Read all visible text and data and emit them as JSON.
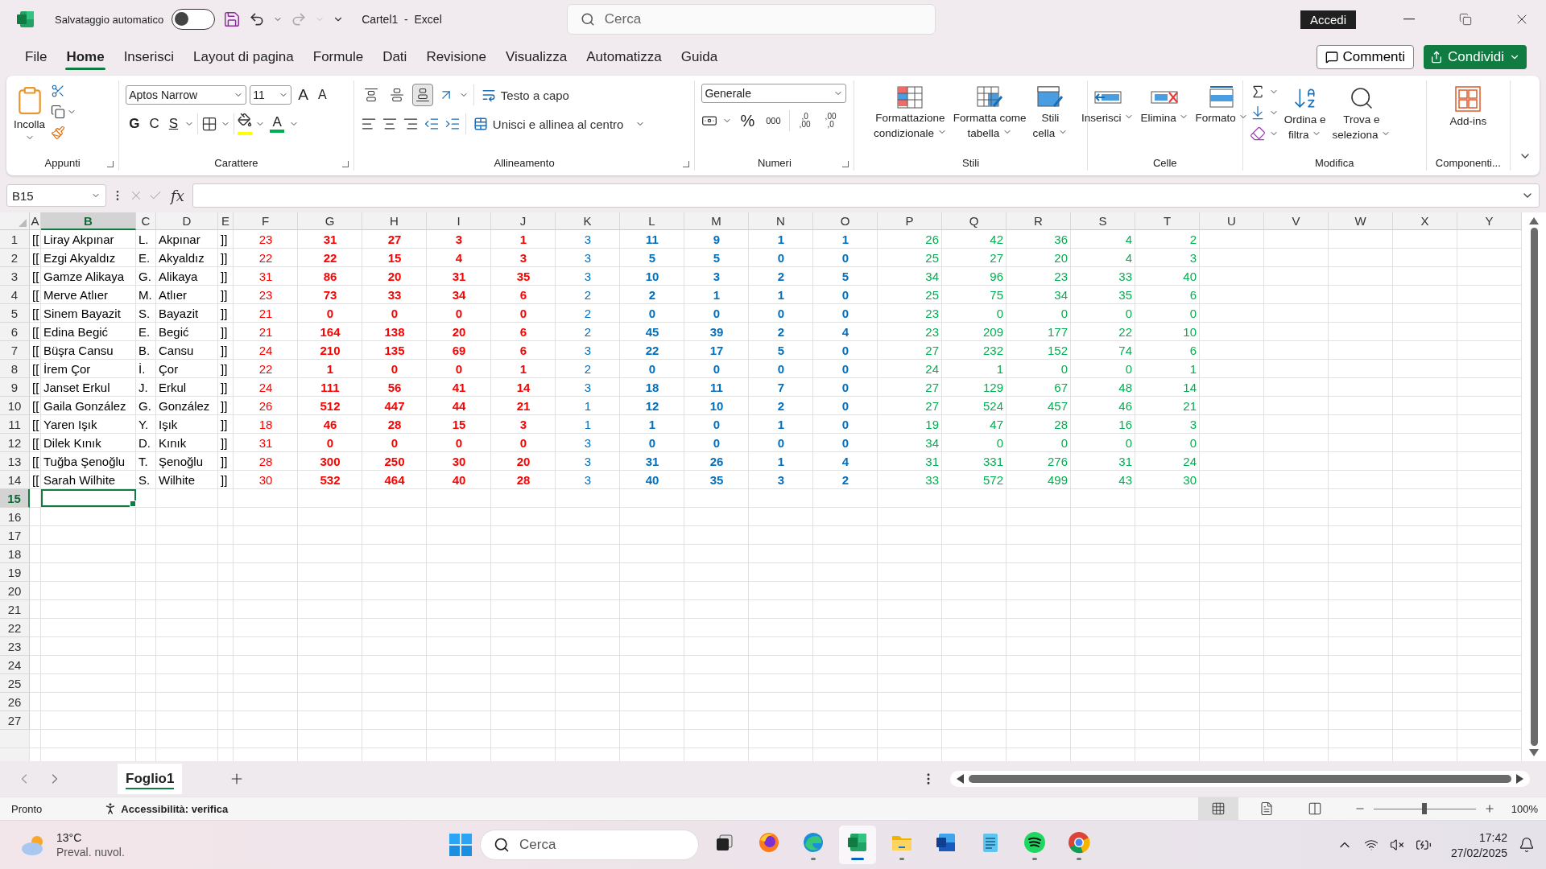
{
  "title_bar": {
    "autosave": {
      "label": "Salvataggio automatico",
      "on": false
    },
    "document_title": "Cartel1  -  Excel",
    "search": {
      "placeholder": "Cerca"
    },
    "account_button": "Accedi"
  },
  "menu_tabs": [
    {
      "label": "File",
      "selected": false
    },
    {
      "label": "Home",
      "selected": true
    },
    {
      "label": "Inserisci",
      "selected": false
    },
    {
      "label": "Layout di pagina",
      "selected": false
    },
    {
      "label": "Formule",
      "selected": false
    },
    {
      "label": "Dati",
      "selected": false
    },
    {
      "label": "Revisione",
      "selected": false
    },
    {
      "label": "Visualizza",
      "selected": false
    },
    {
      "label": "Automatizza",
      "selected": false
    },
    {
      "label": "Guida",
      "selected": false
    }
  ],
  "comments_button": "Commenti",
  "share_button": "Condividi",
  "ribbon": {
    "clipboard": {
      "label": "Appunti",
      "paste": "Incolla"
    },
    "font": {
      "label": "Carattere",
      "font_name": "Aptos Narrow",
      "font_size": "11",
      "grow": "A",
      "shrink": "A",
      "bold": "G",
      "italic": "C",
      "underline": "S",
      "font_color": "A"
    },
    "alignment": {
      "label": "Allineamento",
      "vertical": [
        {
          "selected": false
        },
        {
          "selected": false
        },
        {
          "selected": true
        }
      ],
      "wrap": "Testo a capo",
      "merge": "Unisci e allinea al centro"
    },
    "number": {
      "label": "Numeri",
      "format": "Generale",
      "percent": "%",
      "thousands": "000",
      "increase_decimal": [
        ",0",
        ",00"
      ],
      "decrease_decimal": [
        ",00",
        ",0"
      ]
    },
    "styles": {
      "label": "Stili",
      "buttons": [
        {
          "lines": [
            "Formattazione",
            "condizionale"
          ]
        },
        {
          "lines": [
            "Formatta come",
            "tabella"
          ]
        },
        {
          "lines": [
            "Stili",
            "cella"
          ]
        }
      ]
    },
    "cells": {
      "label": "Celle",
      "buttons": [
        {
          "lines": [
            "Inserisci"
          ]
        },
        {
          "lines": [
            "Elimina"
          ]
        },
        {
          "lines": [
            "Formato"
          ]
        }
      ]
    },
    "editing": {
      "label": "Modifica",
      "buttons": [
        {
          "lines": [
            "Ordina e",
            "filtra"
          ]
        },
        {
          "lines": [
            "Trova e",
            "seleziona"
          ]
        }
      ]
    },
    "addins": {
      "label": "Componenti...",
      "button": "Add-ins"
    }
  },
  "formula_bar": {
    "name_box": "B15",
    "function_label": "fx"
  },
  "columns": [
    {
      "letter": "A",
      "kind": "text",
      "selected": false
    },
    {
      "letter": "B",
      "kind": "text",
      "selected": true
    },
    {
      "letter": "C",
      "kind": "text",
      "selected": false
    },
    {
      "letter": "D",
      "kind": "text",
      "selected": false
    },
    {
      "letter": "E",
      "kind": "text",
      "selected": false
    },
    {
      "letter": "F",
      "kind": "centered",
      "color": "#ff0000",
      "bold": false,
      "selected": false
    },
    {
      "letter": "G",
      "kind": "centered",
      "color": "#ff0000",
      "bold": true,
      "selected": false
    },
    {
      "letter": "H",
      "kind": "centered",
      "color": "#ff0000",
      "bold": true,
      "selected": false
    },
    {
      "letter": "I",
      "kind": "centered",
      "color": "#ff0000",
      "bold": true,
      "selected": false
    },
    {
      "letter": "J",
      "kind": "centered",
      "color": "#ff0000",
      "bold": true,
      "selected": false
    },
    {
      "letter": "K",
      "kind": "centered",
      "color": "#0070c0",
      "bold": false,
      "selected": false
    },
    {
      "letter": "L",
      "kind": "centered",
      "color": "#0070c0",
      "bold": true,
      "selected": false
    },
    {
      "letter": "M",
      "kind": "centered",
      "color": "#0070c0",
      "bold": true,
      "selected": false
    },
    {
      "letter": "N",
      "kind": "centered",
      "color": "#0070c0",
      "bold": true,
      "selected": false
    },
    {
      "letter": "O",
      "kind": "centered",
      "color": "#0070c0",
      "bold": true,
      "selected": false
    },
    {
      "letter": "P",
      "kind": "number",
      "color": "#00b050",
      "bold": false,
      "selected": false
    },
    {
      "letter": "Q",
      "kind": "number",
      "color": "#00b050",
      "bold": false,
      "selected": false
    },
    {
      "letter": "R",
      "kind": "number",
      "color": "#00b050",
      "bold": false,
      "selected": false
    },
    {
      "letter": "S",
      "kind": "number",
      "color": "#00b050",
      "bold": false,
      "selected": false
    },
    {
      "letter": "T",
      "kind": "number",
      "color": "#00b050",
      "bold": false,
      "selected": false
    },
    {
      "letter": "U",
      "selected": false
    },
    {
      "letter": "V",
      "selected": false
    },
    {
      "letter": "W",
      "selected": false
    },
    {
      "letter": "X",
      "selected": false
    },
    {
      "letter": "Y",
      "selected": false
    }
  ],
  "rows": [
    {
      "number": "1",
      "selected": false,
      "cells": [
        "[[",
        "Liray Akpınar",
        "L.",
        "Akpınar",
        "]]",
        "23",
        "31",
        "27",
        "3",
        "1",
        "3",
        "11",
        "9",
        "1",
        "1",
        "26",
        "42",
        "36",
        "4",
        "2"
      ]
    },
    {
      "number": "2",
      "selected": false,
      "cells": [
        "[[",
        "Ezgi Akyaldız",
        "E.",
        "Akyaldız",
        "]]",
        "22",
        "22",
        "15",
        "4",
        "3",
        "3",
        "5",
        "5",
        "0",
        "0",
        "25",
        "27",
        "20",
        "4",
        "3"
      ]
    },
    {
      "number": "3",
      "selected": false,
      "cells": [
        "[[",
        "Gamze Alikaya",
        "G.",
        "Alikaya",
        "]]",
        "31",
        "86",
        "20",
        "31",
        "35",
        "3",
        "10",
        "3",
        "2",
        "5",
        "34",
        "96",
        "23",
        "33",
        "40"
      ]
    },
    {
      "number": "4",
      "selected": false,
      "cells": [
        "[[",
        "Merve Atlıer",
        "M.",
        "Atlıer",
        "]]",
        "23",
        "73",
        "33",
        "34",
        "6",
        "2",
        "2",
        "1",
        "1",
        "0",
        "25",
        "75",
        "34",
        "35",
        "6"
      ]
    },
    {
      "number": "5",
      "selected": false,
      "cells": [
        "[[",
        "Sinem Bayazit",
        "S.",
        "Bayazit",
        "]]",
        "21",
        "0",
        "0",
        "0",
        "0",
        "2",
        "0",
        "0",
        "0",
        "0",
        "23",
        "0",
        "0",
        "0",
        "0"
      ]
    },
    {
      "number": "6",
      "selected": false,
      "cells": [
        "[[",
        "Edina Begić",
        "E.",
        "Begić",
        "]]",
        "21",
        "164",
        "138",
        "20",
        "6",
        "2",
        "45",
        "39",
        "2",
        "4",
        "23",
        "209",
        "177",
        "22",
        "10"
      ]
    },
    {
      "number": "7",
      "selected": false,
      "cells": [
        "[[",
        "Büşra Cansu",
        "B.",
        "Cansu",
        "]]",
        "24",
        "210",
        "135",
        "69",
        "6",
        "3",
        "22",
        "17",
        "5",
        "0",
        "27",
        "232",
        "152",
        "74",
        "6"
      ]
    },
    {
      "number": "8",
      "selected": false,
      "cells": [
        "[[",
        "İrem Çor",
        "İ.",
        "Çor",
        "]]",
        "22",
        "1",
        "0",
        "0",
        "1",
        "2",
        "0",
        "0",
        "0",
        "0",
        "24",
        "1",
        "0",
        "0",
        "1"
      ]
    },
    {
      "number": "9",
      "selected": false,
      "cells": [
        "[[",
        "Janset Erkul",
        "J.",
        "Erkul",
        "]]",
        "24",
        "111",
        "56",
        "41",
        "14",
        "3",
        "18",
        "11",
        "7",
        "0",
        "27",
        "129",
        "67",
        "48",
        "14"
      ]
    },
    {
      "number": "10",
      "selected": false,
      "cells": [
        "[[",
        "Gaila González",
        "G.",
        "González",
        "]]",
        "26",
        "512",
        "447",
        "44",
        "21",
        "1",
        "12",
        "10",
        "2",
        "0",
        "27",
        "524",
        "457",
        "46",
        "21"
      ]
    },
    {
      "number": "11",
      "selected": false,
      "cells": [
        "[[",
        "Yaren Işık",
        "Y.",
        "Işık",
        "]]",
        "18",
        "46",
        "28",
        "15",
        "3",
        "1",
        "1",
        "0",
        "1",
        "0",
        "19",
        "47",
        "28",
        "16",
        "3"
      ]
    },
    {
      "number": "12",
      "selected": false,
      "cells": [
        "[[",
        "Dilek Kınık",
        "D.",
        "Kınık",
        "]]",
        "31",
        "0",
        "0",
        "0",
        "0",
        "3",
        "0",
        "0",
        "0",
        "0",
        "34",
        "0",
        "0",
        "0",
        "0"
      ]
    },
    {
      "number": "13",
      "selected": false,
      "cells": [
        "[[",
        "Tuğba Şenoğlu",
        "T.",
        "Şenoğlu",
        "]]",
        "28",
        "300",
        "250",
        "30",
        "20",
        "3",
        "31",
        "26",
        "1",
        "4",
        "31",
        "331",
        "276",
        "31",
        "24"
      ]
    },
    {
      "number": "14",
      "selected": false,
      "cells": [
        "[[",
        "Sarah Wilhite",
        "S.",
        "Wilhite",
        "]]",
        "30",
        "532",
        "464",
        "40",
        "28",
        "3",
        "40",
        "35",
        "3",
        "2",
        "33",
        "572",
        "499",
        "43",
        "30"
      ]
    },
    {
      "number": "15",
      "selected": true
    },
    {
      "number": "16",
      "selected": false
    },
    {
      "number": "17",
      "selected": false
    },
    {
      "number": "18",
      "selected": false
    },
    {
      "number": "19",
      "selected": false
    },
    {
      "number": "20",
      "selected": false
    },
    {
      "number": "21",
      "selected": false
    },
    {
      "number": "22",
      "selected": false
    },
    {
      "number": "23",
      "selected": false
    },
    {
      "number": "24",
      "selected": false
    },
    {
      "number": "25",
      "selected": false
    },
    {
      "number": "26",
      "selected": false
    },
    {
      "number": "27",
      "selected": false
    }
  ],
  "sheet_tabs": [
    {
      "label": "Foglio1",
      "selected": true
    }
  ],
  "status_bar": {
    "ready": "Pronto",
    "accessibility": "Accessibilità: verifica",
    "views": [
      {
        "selected": true
      },
      {
        "selected": false
      },
      {
        "selected": false
      }
    ],
    "zoom": {
      "level": 0.5,
      "reading": "100%"
    }
  },
  "taskbar": {
    "weather": {
      "temperature": "13°C",
      "condition": "Preval. nuvol."
    },
    "search": {
      "placeholder": "Cerca"
    },
    "apps": [
      {
        "running": false,
        "active": false
      },
      {
        "running": false,
        "active": false
      },
      {
        "running": true,
        "active": false
      },
      {
        "running": true,
        "active": true
      },
      {
        "running": true,
        "active": false
      },
      {
        "running": false,
        "active": false
      },
      {
        "running": false,
        "active": false
      },
      {
        "running": true,
        "active": false
      },
      {
        "running": true,
        "active": false
      }
    ],
    "time": "17:42",
    "date": "27/02/2025"
  }
}
